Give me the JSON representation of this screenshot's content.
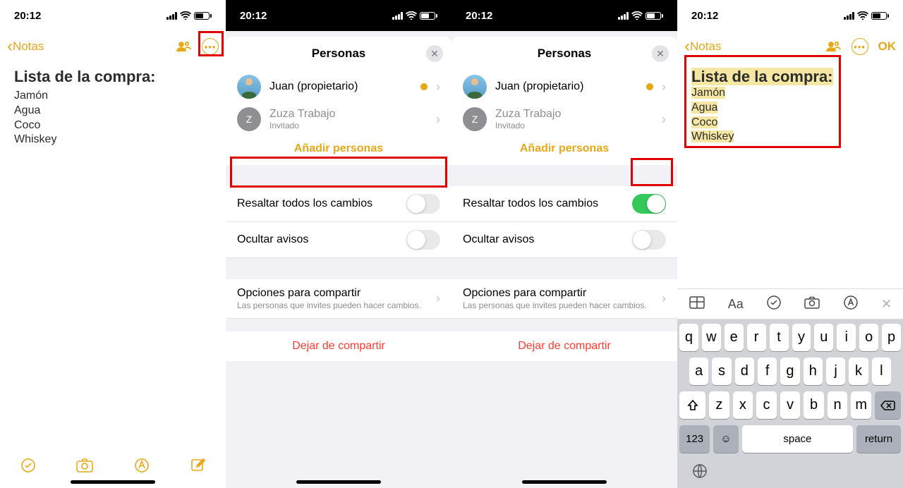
{
  "status": {
    "time": "20:12"
  },
  "nav": {
    "back": "Notas",
    "ok": "OK"
  },
  "note": {
    "title": "Lista de la compra:",
    "items": [
      "Jamón",
      "Agua",
      "Coco",
      "Whiskey"
    ]
  },
  "sheet": {
    "title": "Personas",
    "owner": {
      "name": "Juan (propietario)"
    },
    "guest": {
      "name": "Zuza Trabajo",
      "role": "Invitado",
      "initial": "Z"
    },
    "add": "Añadir personas"
  },
  "settings": {
    "highlight": "Resaltar todos los cambios",
    "hide": "Ocultar avisos",
    "share_options": "Opciones para compartir",
    "share_sub": "Las personas que invites pueden hacer cambios.",
    "stop": "Dejar de compartir"
  },
  "keyboard": {
    "format_label": "Aa",
    "row1": [
      "q",
      "w",
      "e",
      "r",
      "t",
      "y",
      "u",
      "i",
      "o",
      "p"
    ],
    "row2": [
      "a",
      "s",
      "d",
      "f",
      "g",
      "h",
      "j",
      "k",
      "l"
    ],
    "row3": [
      "z",
      "x",
      "c",
      "v",
      "b",
      "n",
      "m"
    ],
    "num": "123",
    "space": "space",
    "return": "return"
  }
}
